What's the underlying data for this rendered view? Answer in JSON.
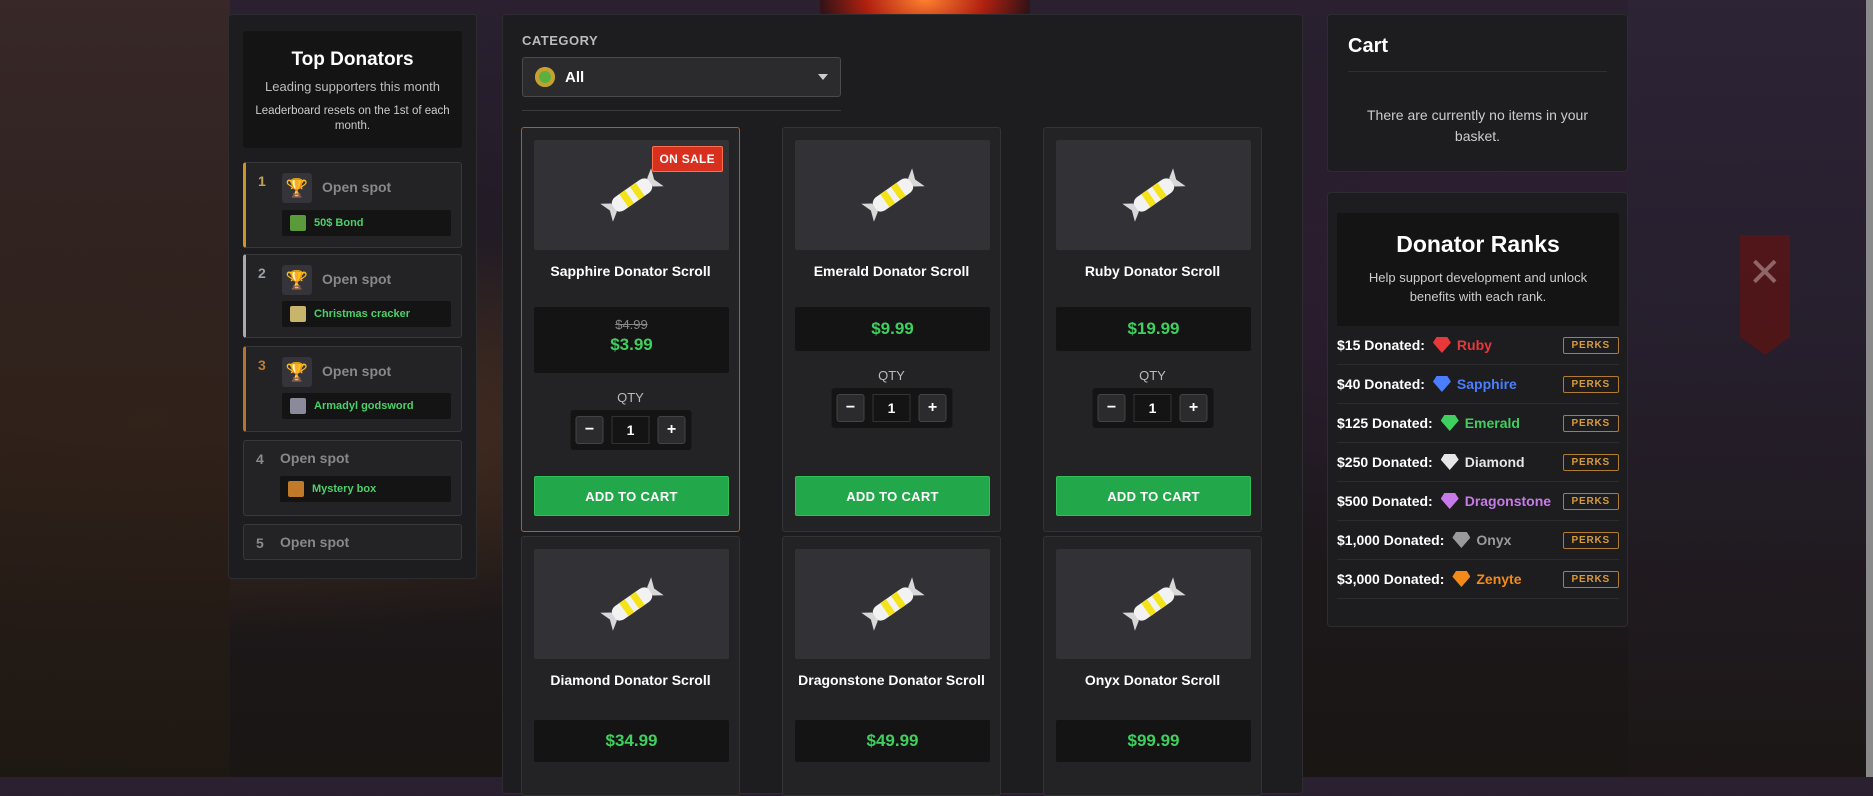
{
  "categories": {
    "label": "CATEGORY",
    "selected": "All"
  },
  "donators": {
    "title": "Top Donators",
    "subtitle": "Leading supporters this month",
    "note": "Leaderboard resets on the 1st of each month.",
    "spots": [
      {
        "rank": "1",
        "name": "Open spot",
        "item": "50$ Bond",
        "item_icon": "bond-icon"
      },
      {
        "rank": "2",
        "name": "Open spot",
        "item": "Christmas cracker",
        "item_icon": "cracker-icon"
      },
      {
        "rank": "3",
        "name": "Open spot",
        "item": "Armadyl godsword",
        "item_icon": "sword-icon"
      },
      {
        "rank": "4",
        "name": "Open spot",
        "item": "Mystery box",
        "item_icon": "box-icon"
      },
      {
        "rank": "5",
        "name": "Open spot"
      }
    ]
  },
  "products": [
    {
      "name": "Sapphire Donator Scroll",
      "badge": "ON SALE",
      "old_price": "$4.99",
      "price": "$3.99",
      "qty_label": "QTY",
      "qty": "1",
      "button": "ADD TO CART"
    },
    {
      "name": "Emerald Donator Scroll",
      "price": "$9.99",
      "qty_label": "QTY",
      "qty": "1",
      "button": "ADD TO CART"
    },
    {
      "name": "Ruby Donator Scroll",
      "price": "$19.99",
      "qty_label": "QTY",
      "qty": "1",
      "button": "ADD TO CART"
    },
    {
      "name": "Diamond Donator Scroll",
      "price": "$34.99"
    },
    {
      "name": "Dragonstone Donator Scroll",
      "price": "$49.99"
    },
    {
      "name": "Onyx Donator Scroll",
      "price": "$99.99"
    }
  ],
  "qty_buttons": {
    "minus": "−",
    "plus": "+"
  },
  "cart": {
    "title": "Cart",
    "empty_message": "There are currently no items in your basket."
  },
  "ranks": {
    "title": "Donator Ranks",
    "subtitle": "Help support development and unlock benefits with each rank.",
    "perks_label": "PERKS",
    "items": [
      {
        "amount": "$15 Donated:",
        "name": "Ruby",
        "color": "#e8383a"
      },
      {
        "amount": "$40 Donated:",
        "name": "Sapphire",
        "color": "#4a7dff"
      },
      {
        "amount": "$125 Donated:",
        "name": "Emerald",
        "color": "#3fcf5e"
      },
      {
        "amount": "$250 Donated:",
        "name": "Diamond",
        "color": "#e6e6e6"
      },
      {
        "amount": "$500 Donated:",
        "name": "Dragonstone",
        "color": "#c77be8"
      },
      {
        "amount": "$1,000 Donated:",
        "name": "Onyx",
        "color": "#9a9a9a"
      },
      {
        "amount": "$3,000 Donated:",
        "name": "Zenyte",
        "color": "#f28a1a"
      }
    ]
  },
  "colors": {
    "accent_green": "#22a84a",
    "price_green": "#3fcf5e",
    "sale_red": "#d8301e",
    "perks_orange": "#d99a3a"
  }
}
